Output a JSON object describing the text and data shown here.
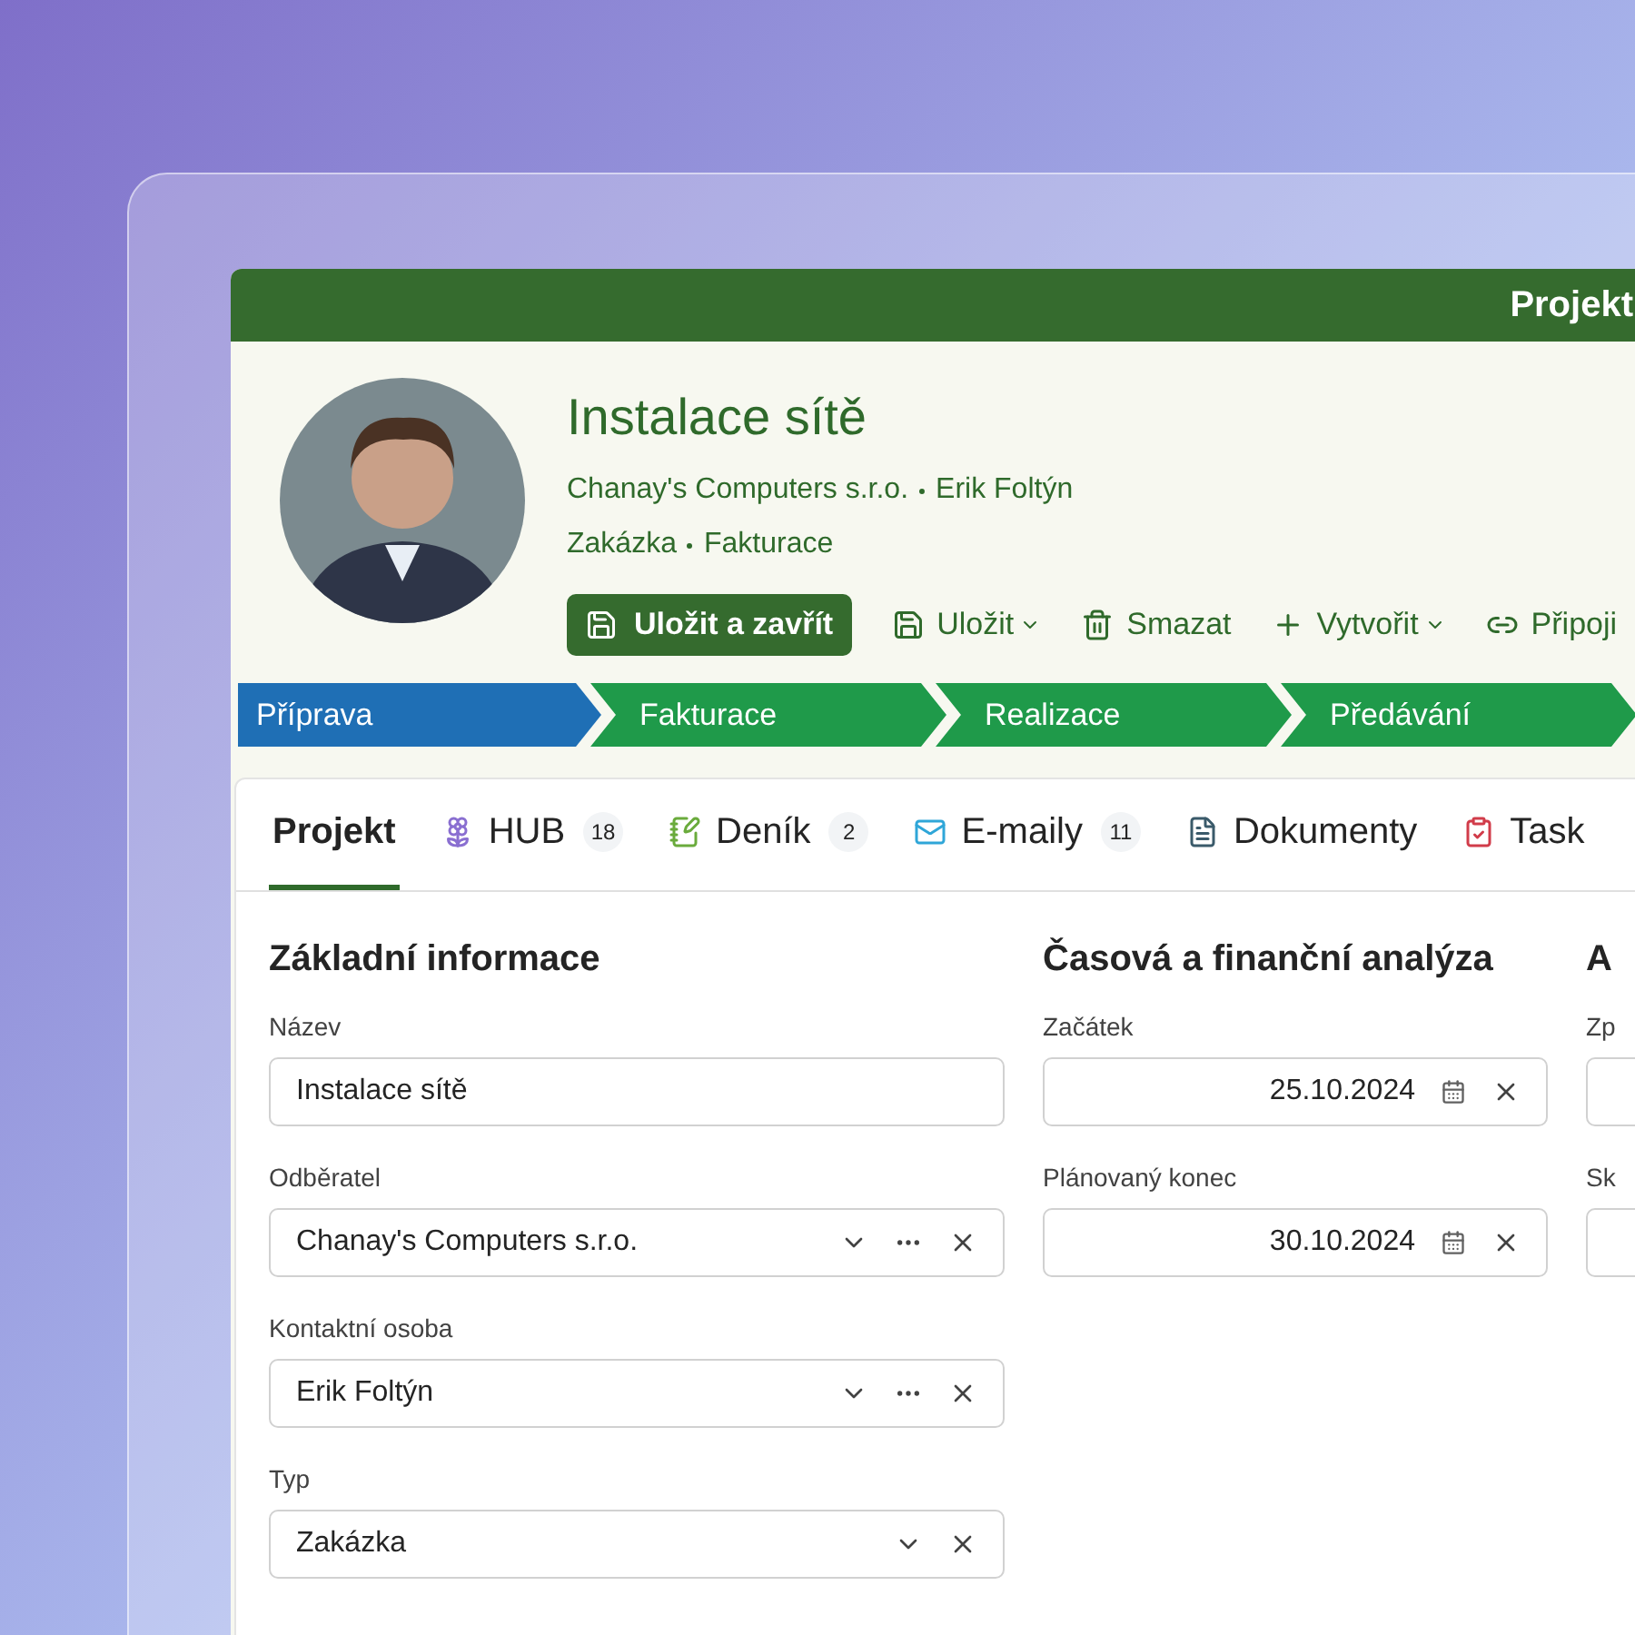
{
  "window": {
    "title": "Projekt"
  },
  "header": {
    "title": "Instalace sítě",
    "line_1": [
      "Chanay's Computers s.r.o.",
      "Erik Foltýn"
    ],
    "line_2": [
      "Zakázka",
      "Fakturace"
    ]
  },
  "toolbar": [
    {
      "kind": "primary",
      "label": "Uložit a zavřít"
    },
    {
      "kind": "menu",
      "label": "Uložit"
    },
    {
      "kind": "plain",
      "label": "Smazat"
    },
    {
      "kind": "menu",
      "label": "Vytvořit"
    },
    {
      "kind": "plain",
      "label": "Připoji"
    }
  ],
  "stages": [
    {
      "label": "Příprava",
      "selected": true
    },
    {
      "label": "Fakturace",
      "selected": false
    },
    {
      "label": "Realizace",
      "selected": false
    },
    {
      "label": "Předávání",
      "selected": false
    }
  ],
  "tabs": [
    {
      "label": "Projekt",
      "selected": true
    },
    {
      "label": "HUB",
      "count": "18",
      "selected": false
    },
    {
      "label": "Deník",
      "count": "2",
      "selected": false
    },
    {
      "label": "E-maily",
      "count": "11",
      "selected": false
    },
    {
      "label": "Dokumenty",
      "selected": false
    },
    {
      "label": "Task",
      "selected": false
    }
  ],
  "sections": [
    {
      "title": "Základní informace",
      "fields": [
        {
          "label": "Název",
          "kind": "text",
          "value": "Instalace sítě"
        },
        {
          "label": "Odběratel",
          "kind": "lookup",
          "value": "Chanay's Computers s.r.o."
        },
        {
          "label": "Kontaktní osoba",
          "kind": "lookup",
          "value": "Erik Foltýn"
        },
        {
          "label": "Typ",
          "kind": "choice",
          "value": "Zakázka"
        }
      ]
    },
    {
      "title": "Časová a finanční analýza",
      "fields": [
        {
          "label": "Začátek",
          "kind": "date",
          "value": "25.10.2024"
        },
        {
          "label": "Plánovaný konec",
          "kind": "date",
          "value": "30.10.2024"
        }
      ]
    },
    {
      "title": "A",
      "fields": [
        {
          "label": "Zp",
          "kind": "text"
        },
        {
          "label": "Sk",
          "kind": "text"
        }
      ]
    }
  ]
}
